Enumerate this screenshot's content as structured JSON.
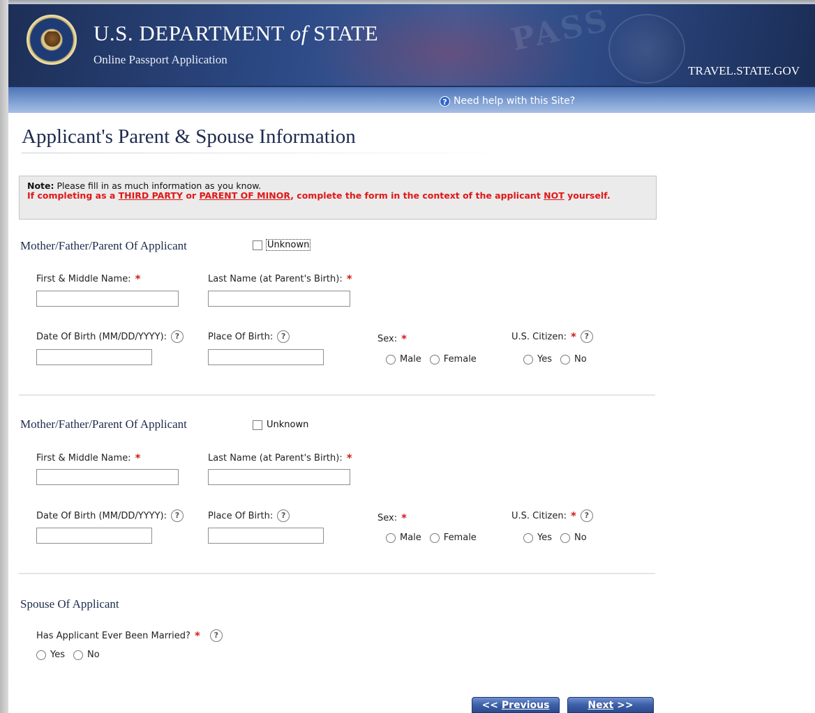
{
  "header": {
    "title_pre": "U.S. DEPARTMENT ",
    "title_of": "of",
    "title_post": " STATE",
    "subtitle": "Online Passport Application",
    "watermark": "PASS",
    "travel_link": "TRAVEL.STATE.GOV"
  },
  "helpbar": {
    "help_text": "Need help with this Site?"
  },
  "page": {
    "title": "Applicant's Parent & Spouse Information"
  },
  "note": {
    "label": "Note:",
    "text": " Please fill in as much information as you know.",
    "warn_1": "If completing as a ",
    "warn_third_party": "THIRD PARTY",
    "warn_2": " or ",
    "warn_parent_minor": "PARENT OF MINOR",
    "warn_3": ", complete the form in the context of the applicant ",
    "warn_not": "NOT",
    "warn_4": " yourself."
  },
  "parent1": {
    "title": "Mother/Father/Parent Of Applicant",
    "unknown": "Unknown",
    "first_name_label": "First & Middle Name:",
    "last_name_label": "Last Name (at Parent's Birth):",
    "dob_label": "Date Of Birth (MM/DD/YYYY):",
    "pob_label": "Place Of Birth:",
    "sex_label": "Sex:",
    "sex_male": "Male",
    "sex_female": "Female",
    "citizen_label": "U.S. Citizen:",
    "citizen_yes": "Yes",
    "citizen_no": "No"
  },
  "parent2": {
    "title": "Mother/Father/Parent Of Applicant",
    "unknown": "Unknown",
    "first_name_label": "First & Middle Name:",
    "last_name_label": "Last Name (at Parent's Birth):",
    "dob_label": "Date Of Birth (MM/DD/YYYY):",
    "pob_label": "Place Of Birth:",
    "sex_label": "Sex:",
    "sex_male": "Male",
    "sex_female": "Female",
    "citizen_label": "U.S. Citizen:",
    "citizen_yes": "Yes",
    "citizen_no": "No"
  },
  "spouse": {
    "title": "Spouse Of Applicant",
    "married_label": "Has Applicant Ever Been Married?",
    "yes": "Yes",
    "no": "No"
  },
  "nav": {
    "previous_prefix": "<< ",
    "previous_u": "P",
    "previous_rest": "revious",
    "next_u": "N",
    "next_rest": "ext",
    "next_suffix": " >>"
  },
  "icons": {
    "help": "question-circle-icon",
    "required": "asterisk-icon",
    "seal": "department-seal-icon"
  },
  "colors": {
    "header_blue": "#2d4a86",
    "helpbar_blue": "#7e9fd3",
    "required_red": "#d21b1b",
    "warn_red": "#e11717",
    "title_navy": "#1d2a4d"
  }
}
